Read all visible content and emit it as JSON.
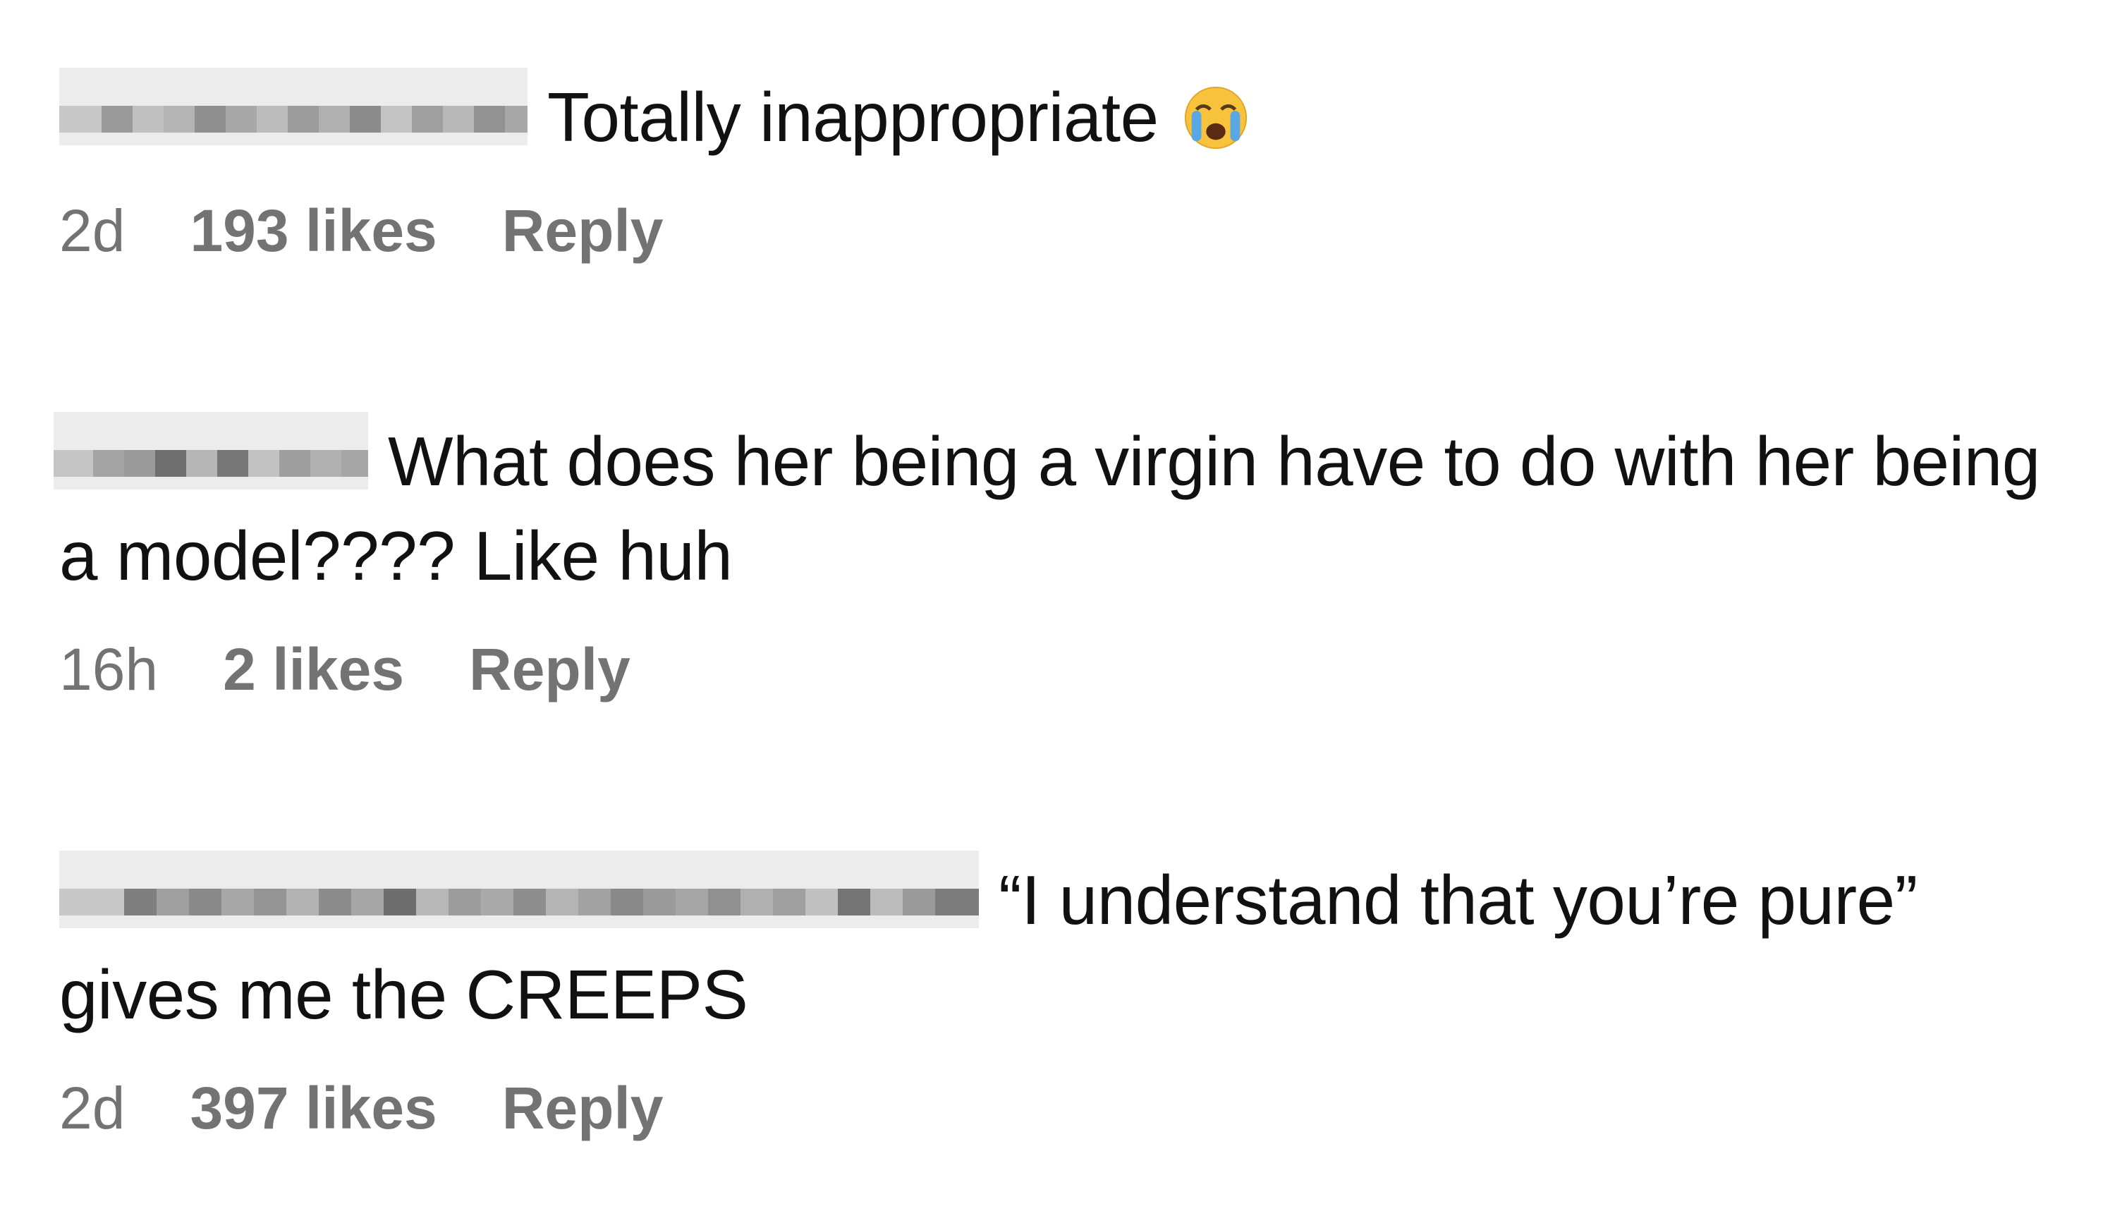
{
  "comments": [
    {
      "text": "Totally inappropriate",
      "emoji": "loudly-crying-face-emoji",
      "age": "2d",
      "likes": "193 likes",
      "reply": "Reply"
    },
    {
      "text": "What does her being a virgin have to do with her being a model???? Like huh",
      "age": "16h",
      "likes": "2 likes",
      "reply": "Reply"
    },
    {
      "text": "“I understand that you’re pure” gives me the CREEPS",
      "age": "2d",
      "likes": "397 likes",
      "reply": "Reply"
    }
  ],
  "colors": {
    "text": "#111111",
    "meta": "#737373",
    "blur_light": "#e6e6e6",
    "blur_mid": "#b8b8b8",
    "blur_dark": "#7a7a7a"
  }
}
